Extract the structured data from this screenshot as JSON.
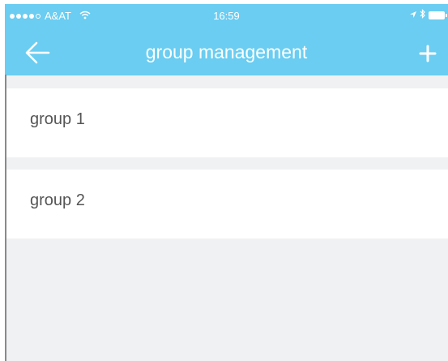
{
  "status_bar": {
    "carrier": "A&AT",
    "time": "16:59"
  },
  "nav": {
    "title": "group management",
    "back_icon": "arrow-left-icon",
    "add_icon": "plus-icon"
  },
  "groups": [
    {
      "label": "group 1"
    },
    {
      "label": "group 2"
    }
  ],
  "colors": {
    "accent": "#6acdf1",
    "background": "#f0f1f3",
    "item_text": "#555555"
  }
}
